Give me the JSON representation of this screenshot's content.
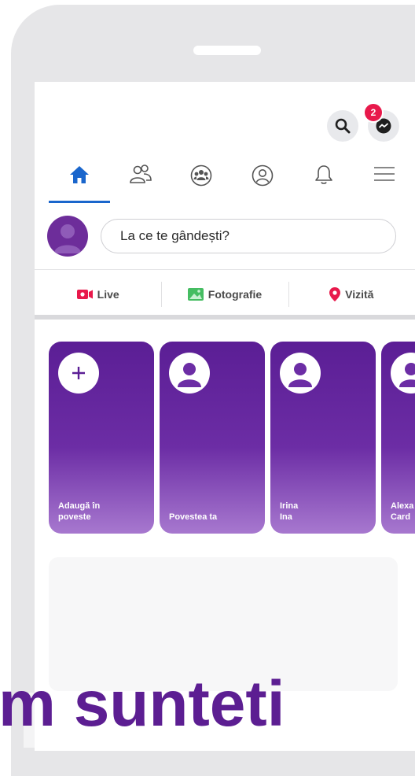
{
  "header": {
    "messenger_badge": "2"
  },
  "nav": {
    "items": [
      {
        "icon": "home-icon",
        "active": true
      },
      {
        "icon": "friends-icon",
        "active": false
      },
      {
        "icon": "groups-icon",
        "active": false
      },
      {
        "icon": "profile-icon",
        "active": false
      },
      {
        "icon": "bell-icon",
        "active": false
      },
      {
        "icon": "menu-icon",
        "active": false
      }
    ]
  },
  "composer": {
    "placeholder": "La ce te gândești?"
  },
  "actions": {
    "live_label": "Live",
    "photo_label": "Fotografie",
    "checkin_label": "Vizită"
  },
  "stories": {
    "items": [
      {
        "line1": "Adaugă în",
        "line2": "poveste"
      },
      {
        "line1": "Povestea ta",
        "line2": ""
      },
      {
        "line1": "Irina",
        "line2": "Ina"
      },
      {
        "line1": "Alexa",
        "line2": "Card"
      }
    ]
  },
  "overlay": {
    "text": "m sunteti"
  },
  "colors": {
    "accent": "#1a66cc",
    "story_purple": "#5b1e95",
    "badge_red": "#e8194b",
    "overlay_purple": "#5c1e92"
  }
}
